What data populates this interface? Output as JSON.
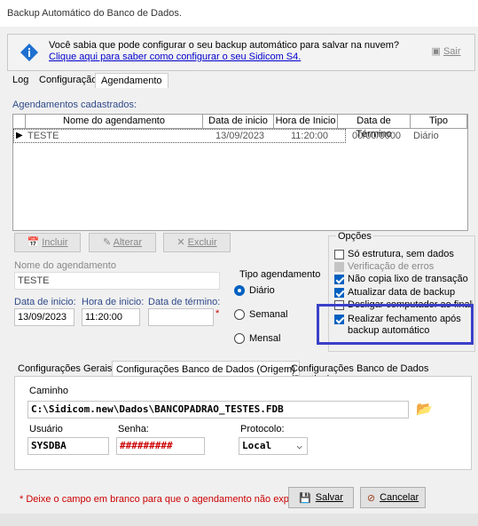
{
  "window": {
    "title": "Backup Automático do Banco de Dados."
  },
  "infobar": {
    "message": "Você sabia que pode configurar o seu backup automático para salvar na nuvem?",
    "link": "Clique aqui para saber como configurar o seu Sidicom S4.",
    "exit_label": "Sair"
  },
  "tabs": [
    "Log",
    "Configuração",
    "Agendamento"
  ],
  "agendamentos": {
    "label": "Agendamentos cadastrados:",
    "columns": [
      "Nome do agendamento",
      "Data de inicio",
      "Hora de Inicio",
      "Data de Término",
      "Tipo"
    ],
    "rows": [
      {
        "marker": "▶",
        "nome": "TESTE",
        "data_inicio": "13/09/2023",
        "hora_inicio": "11:20:00",
        "data_termino": "00/00/0000",
        "tipo": "Diário"
      }
    ]
  },
  "actions": {
    "incluir": "Incluir",
    "alterar": "Alterar",
    "excluir": "Excluir"
  },
  "form": {
    "nome_label": "Nome do agendamento",
    "nome_value": "TESTE",
    "data_inicio_label": "Data de inicio:",
    "data_inicio_value": "13/09/2023",
    "hora_inicio_label": "Hora de inicio:",
    "hora_inicio_value": "11:20:00",
    "data_termino_label": "Data de término:",
    "data_termino_value": "",
    "required_mark": "*"
  },
  "tipo_agendamento": {
    "label": "Tipo agendamento",
    "options": [
      "Diário",
      "Semanal",
      "Mensal"
    ],
    "selected": "Diário"
  },
  "opcoes": {
    "label": "Opções",
    "items": [
      {
        "label": "Só estrutura, sem dados",
        "state": "unchecked"
      },
      {
        "label": "Verificação de erros",
        "state": "disabled"
      },
      {
        "label": "Não copia lixo de transação",
        "state": "checked"
      },
      {
        "label": "Atualizar data de backup",
        "state": "checked"
      },
      {
        "label": "Desligar computador ao finalizar",
        "state": "unchecked"
      },
      {
        "label": "Realizar fechamento após",
        "state": "checked"
      },
      {
        "label": "backup automático",
        "state": ""
      }
    ]
  },
  "sub_tabs": [
    "Configurações Gerais",
    "Configurações Banco de Dados (Origem)",
    "Configurações Banco de Dados (Destino)"
  ],
  "db_config": {
    "caminho_label": "Caminho",
    "caminho_value": "C:\\Sidicom.new\\Dados\\BANCOPADRAO_TESTES.FDB",
    "usuario_label": "Usuário",
    "usuario_value": "SYSDBA",
    "senha_label": "Senha:",
    "senha_value": "#########",
    "protocolo_label": "Protocolo:",
    "protocolo_value": "Local"
  },
  "footer": {
    "note": "* Deixe o campo em branco para que o agendamento não expire.",
    "salvar": "Salvar",
    "cancelar": "Cancelar"
  },
  "colors": {
    "highlight": "#3a40c8",
    "accent": "#0060c0",
    "link": "#0000cc",
    "senha": "#cc0000"
  }
}
